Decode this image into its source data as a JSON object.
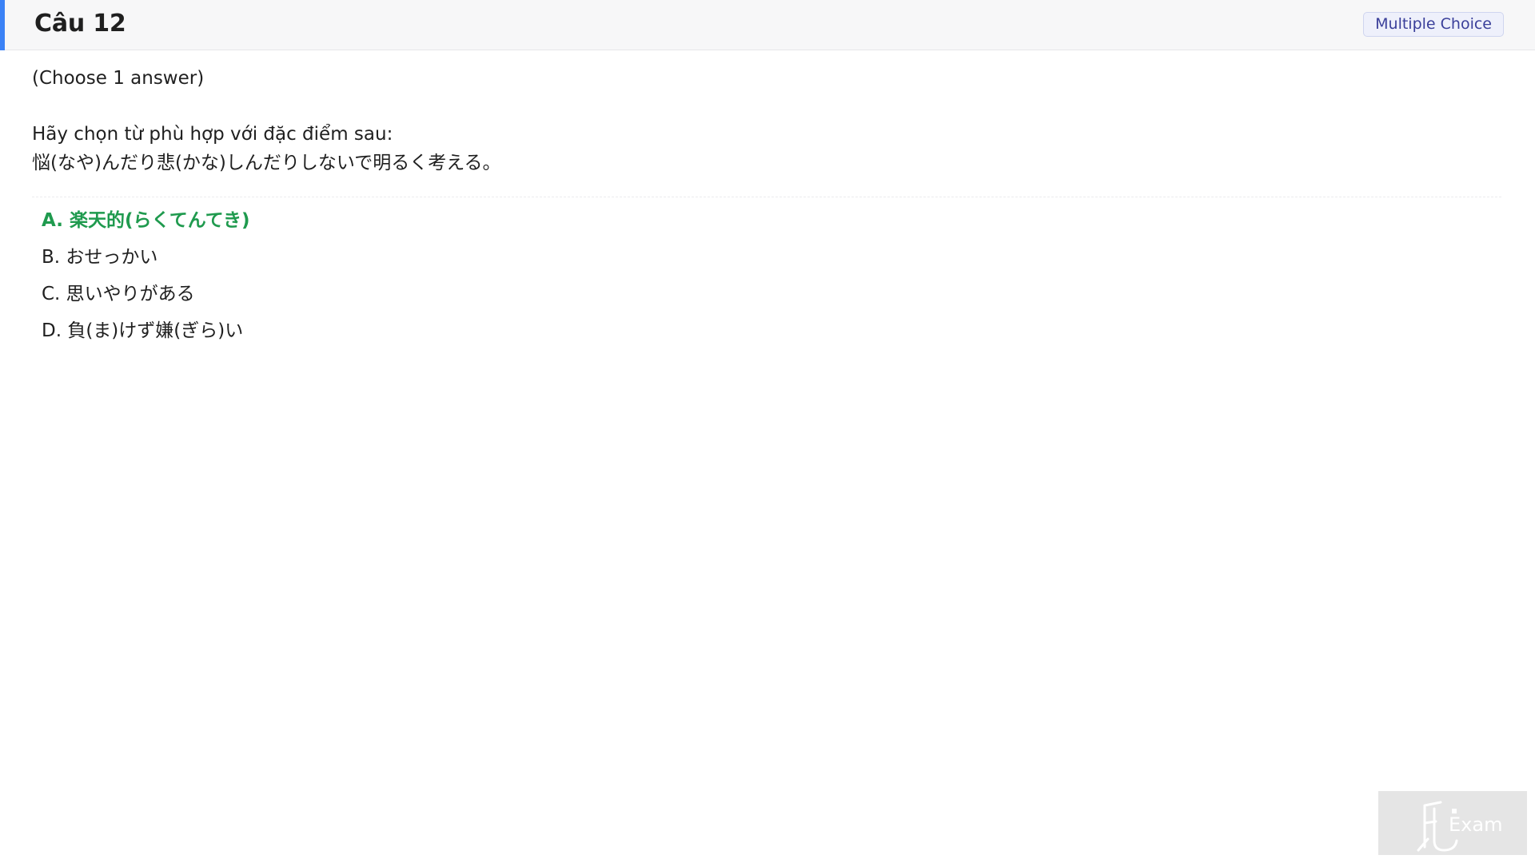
{
  "header": {
    "title": "Câu 12",
    "badge": "Multiple Choice"
  },
  "question": {
    "instruction": "(Choose 1 answer)",
    "prompt_line1": "Hãy chọn từ phù hợp với đặc điểm sau:",
    "prompt_line2": "悩(なや)んだり悲(かな)しんだりしないで明るく考える。"
  },
  "options": [
    {
      "label": "A. 楽天的(らくてんてき)",
      "correct": true
    },
    {
      "label": "B. おせっかい",
      "correct": false
    },
    {
      "label": "C. 思いやりがある",
      "correct": false
    },
    {
      "label": "D. 負(ま)けず嫌(ぎら)い",
      "correct": false
    }
  ],
  "watermark": {
    "text": "Exam",
    "colors": {
      "logo": "#ffffff",
      "background": "#e5e5e5"
    }
  },
  "colors": {
    "accent": "#3b82f6",
    "correct": "#1f9a4e",
    "badge_text": "#3a3f9a"
  }
}
